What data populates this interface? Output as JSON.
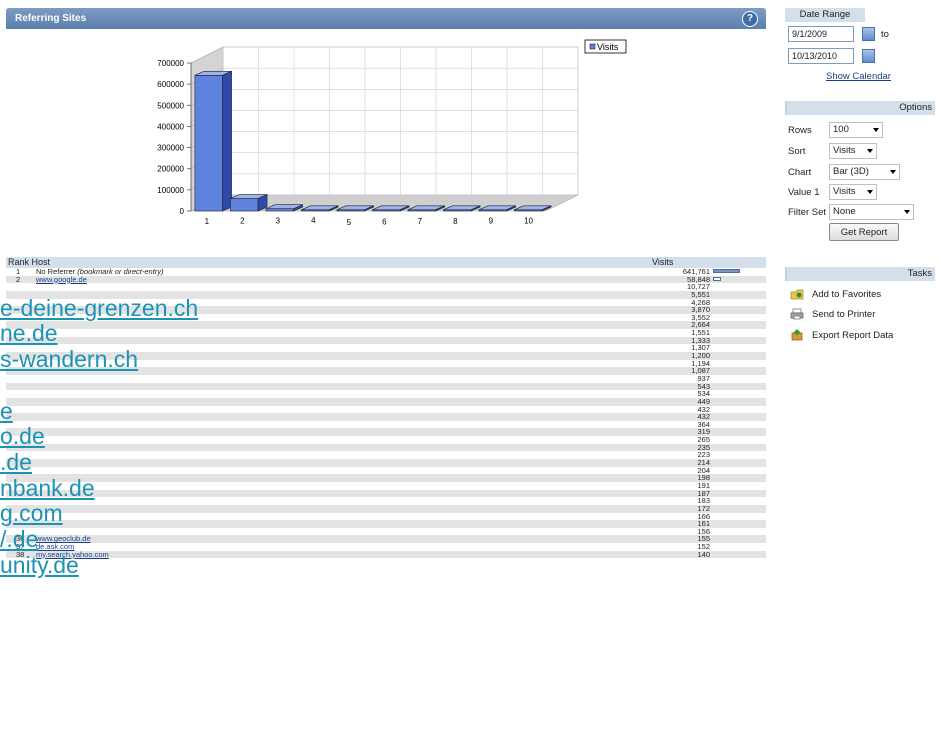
{
  "panel": {
    "title": "Referring Sites",
    "help": "?"
  },
  "chart_data": {
    "type": "bar",
    "three_d": true,
    "categories": [
      "1",
      "2",
      "3",
      "4",
      "5",
      "6",
      "7",
      "8",
      "9",
      "10"
    ],
    "series": [
      {
        "name": "Visits",
        "values": [
          641761,
          58848,
          10727,
          5551,
          4268,
          3870,
          3552,
          2664,
          1551,
          1333
        ]
      }
    ],
    "ylim": [
      0,
      700000
    ],
    "yticks": [
      "700000",
      "600000",
      "500000",
      "400000",
      "300000",
      "200000",
      "100000",
      "0"
    ],
    "legend_position": "top-right",
    "grid": true,
    "bar_color": "#5f82df"
  },
  "table": {
    "header": {
      "rank_host": "Rank Host",
      "visits": "Visits"
    },
    "max_visits": 641761,
    "rows": [
      {
        "rank": "1",
        "host": "No Referrer",
        "host_note": " (bookmark or direct-entry)",
        "visits": "641,761",
        "value": 641761
      },
      {
        "rank": "2",
        "host": "www.google.de",
        "visits": "58,848",
        "value": 58848
      },
      {
        "rank": "",
        "host": "",
        "visits": "10,727"
      },
      {
        "rank": "",
        "host": "",
        "visits": "5,551"
      },
      {
        "rank": "",
        "host": "",
        "visits": "4,268"
      },
      {
        "rank": "",
        "host": "",
        "visits": "3,870"
      },
      {
        "rank": "",
        "host": "",
        "visits": "3,552"
      },
      {
        "rank": "",
        "host": "",
        "visits": "2,664"
      },
      {
        "rank": "",
        "host": "",
        "visits": "1,551"
      },
      {
        "rank": "",
        "host": "",
        "visits": "1,333"
      },
      {
        "rank": "",
        "host": "",
        "visits": "1,307"
      },
      {
        "rank": "",
        "host": "",
        "visits": "1,200"
      },
      {
        "rank": "",
        "host": "",
        "visits": "1,194"
      },
      {
        "rank": "",
        "host": "",
        "visits": "1,087"
      },
      {
        "rank": "",
        "host": "",
        "visits": "937"
      },
      {
        "rank": "",
        "host": "",
        "visits": "543"
      },
      {
        "rank": "",
        "host": "",
        "visits": "534"
      },
      {
        "rank": "",
        "host": "",
        "visits": "449"
      },
      {
        "rank": "",
        "host": "",
        "visits": "432"
      },
      {
        "rank": "",
        "host": "",
        "visits": "432"
      },
      {
        "rank": "",
        "host": "",
        "visits": "364"
      },
      {
        "rank": "",
        "host": "",
        "visits": "319"
      },
      {
        "rank": "",
        "host": "",
        "visits": "265"
      },
      {
        "rank": "",
        "host": "",
        "visits": "235"
      },
      {
        "rank": "",
        "host": "",
        "visits": "223"
      },
      {
        "rank": "",
        "host": "",
        "visits": "214"
      },
      {
        "rank": "",
        "host": "",
        "visits": "204"
      },
      {
        "rank": "",
        "host": "",
        "visits": "198"
      },
      {
        "rank": "",
        "host": "",
        "visits": "191"
      },
      {
        "rank": "",
        "host": "",
        "visits": "187"
      },
      {
        "rank": "",
        "host": "",
        "visits": "183"
      },
      {
        "rank": "",
        "host": "",
        "visits": "172"
      },
      {
        "rank": "",
        "host": "",
        "visits": "166"
      },
      {
        "rank": "",
        "host": "",
        "visits": "161"
      },
      {
        "rank": "",
        "host": "",
        "visits": "156"
      },
      {
        "rank": "36",
        "host": "www.geoclub.de",
        "visits": "155"
      },
      {
        "rank": "37",
        "host": "de.ask.com",
        "visits": "152"
      },
      {
        "rank": "38",
        "host": "my.search.yahoo.com",
        "visits": "140"
      }
    ]
  },
  "overlay_links": [
    "e-deine-grenzen.ch",
    "ne.de",
    "s-wandern.ch",
    "e",
    "o.de",
    ".de",
    "nbank.de",
    "g.com",
    "/.de",
    "unity.de"
  ],
  "sidebar": {
    "date_range": {
      "title": "Date Range",
      "from": "9/1/2009",
      "to_label": "to",
      "to": "10/13/2010",
      "show_calendar": "Show Calendar"
    },
    "options": {
      "title": "Options",
      "rows_label": "Rows",
      "rows_value": "100",
      "sort_label": "Sort",
      "sort_value": "Visits",
      "chart_label": "Chart",
      "chart_value": "Bar (3D)",
      "value1_label": "Value 1",
      "value1_value": "Visits",
      "filter_label": "Filter Set",
      "filter_value": "None",
      "get_report": "Get Report"
    },
    "tasks": {
      "title": "Tasks",
      "favorites": "Add to Favorites",
      "printer": "Send to Printer",
      "export": "Export Report Data"
    }
  }
}
